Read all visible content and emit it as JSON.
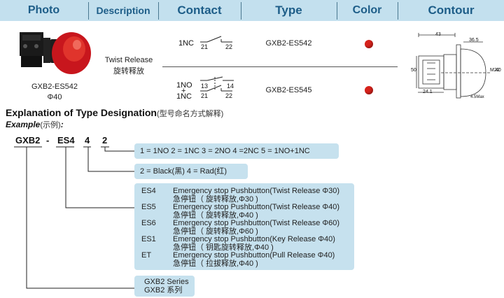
{
  "header": {
    "photo": "Photo",
    "description": "Description",
    "contact": "Contact",
    "type": "Type",
    "color": "Color",
    "contour": "Contour"
  },
  "product": {
    "photo_caption_model": "GXB2-ES542",
    "photo_caption_size": "Φ40",
    "description_en": "Twist Release",
    "description_cn": "旋转释放",
    "rows": [
      {
        "contact_label_line1": "1NC",
        "contact_terminals": [
          "21",
          "22"
        ],
        "type": "GXB2-ES542",
        "color": "#d6221b"
      },
      {
        "contact_label_line1": "1NO",
        "contact_label_plus": "+",
        "contact_label_line2": "1NC",
        "contact_terminals_no": [
          "13",
          "14"
        ],
        "contact_terminals_nc": [
          "21",
          "22"
        ],
        "type": "GXB2-ES545",
        "color": "#d6221b"
      }
    ],
    "contour_dims": {
      "d43": "43",
      "d365": "36.5",
      "d241": "24.1",
      "d50": "50",
      "m22": "M22",
      "d40": "40",
      "dmax": "4.5Max"
    }
  },
  "explanation": {
    "title": "Explanation of Type Designation",
    "title_cn": "(型号命名方式解释)",
    "example": "Example",
    "example_cn": "(示例)",
    "example_colon": ":"
  },
  "designation": {
    "part_series": "GXB2",
    "dash": "-",
    "part_function": "ES4",
    "part_color": "4",
    "part_contact": "2"
  },
  "contact_box": "1 = 1NO   2 = 1NC  3 = 2NO 4 =2NC 5 = 1NO+1NC",
  "color_box": "2 = Black(黑)   4 = Rad(红)",
  "function_options": [
    {
      "code": "ES4",
      "en": "Emergency stop Pushbutton(Twist Release Φ30)",
      "cn": "急停钮（ 旋转释放,Φ30 )"
    },
    {
      "code": "ES5",
      "en": "Emergency stop Pushbutton(Twist Release Φ40)",
      "cn": "急停钮（ 旋转释放,Φ40 )"
    },
    {
      "code": "ES6",
      "en": "Emergency stop Pushbutton(Twist Release Φ60)",
      "cn": "急停钮（ 旋转释放,Φ60 )"
    },
    {
      "code": "ES1",
      "en": "Emergency stop Pushbutton(Key Release    Φ40)",
      "cn": "急停钮（ 钥匙旋转释放,Φ40 )"
    },
    {
      "code": "ET",
      "en": "Emergency stop Pushbutton(Pull Release   Φ40)",
      "cn": "急停钮（ 拉拔释放,Φ40 )"
    }
  ],
  "series_box": {
    "en": "GXB2 Series",
    "cn": "GXB2 系列"
  }
}
